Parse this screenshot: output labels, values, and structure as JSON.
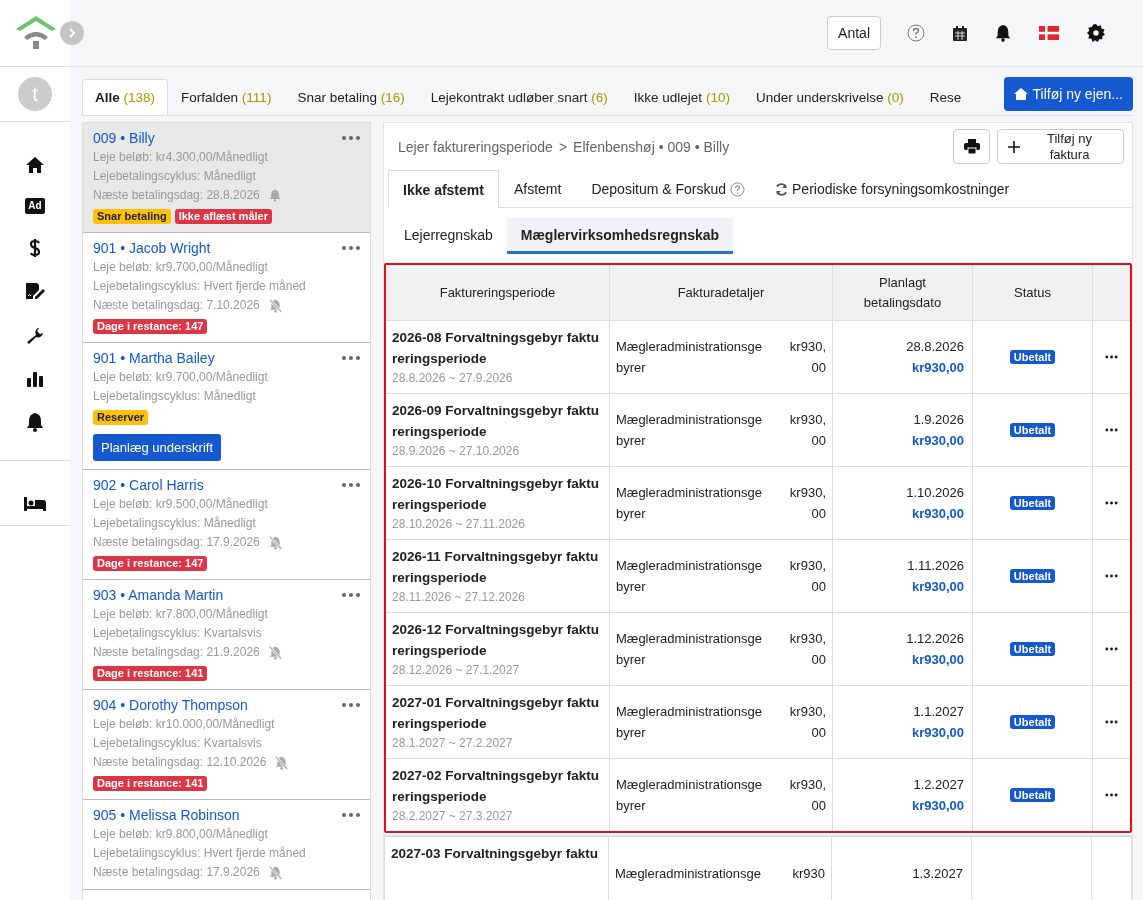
{
  "sidebar": {
    "avatar": "t",
    "nav": [
      {
        "kind": "home"
      },
      {
        "kind": "ad",
        "label": "Ad"
      },
      {
        "kind": "dollar"
      },
      {
        "kind": "contract"
      },
      {
        "kind": "wrench"
      },
      {
        "kind": "chart"
      },
      {
        "kind": "bell"
      }
    ],
    "bottom": [
      {
        "kind": "bed"
      }
    ]
  },
  "topbar": {
    "count_button": "Antal"
  },
  "filter_tabs": [
    {
      "label": "Alle",
      "count": "(138)",
      "selected": true
    },
    {
      "label": "Forfalden",
      "count": "(111)",
      "selected": false
    },
    {
      "label": "Snar betaling",
      "count": "(16)",
      "selected": false
    },
    {
      "label": "Lejekontrakt udløber snart",
      "count": "(6)",
      "selected": false
    },
    {
      "label": "Ikke udlejet",
      "count": "(10)",
      "selected": false
    },
    {
      "label": "Under underskrivelse",
      "count": "(0)",
      "selected": false
    },
    {
      "label": "Rese",
      "selected": false
    }
  ],
  "add_property_button": "Tilføj ny ejen...",
  "tenants": [
    {
      "title": "009 • Billy",
      "rent": "Leje beløb: kr4.300,00/Månedligt",
      "cycle": "Lejebetalingscyklus: Månedligt",
      "next": "Næste betalingsdag:  28.8.2026",
      "reminder_muted": false,
      "selected": true,
      "badges": [
        {
          "label": "Snar betaling",
          "color": "#ffc107"
        },
        {
          "label": "Ikke aflæst måler",
          "color": "#dc3545"
        }
      ]
    },
    {
      "title": "901 • Jacob Wright",
      "rent": "Leje beløb: kr9.700,00/Månedligt",
      "cycle": "Lejebetalingscyklus: Hvert fjerde måned",
      "next": "Næste betalingsdag:  7.10.2026",
      "reminder_muted": true,
      "selected": false,
      "badges": [
        {
          "label": "Dage i restance: 147",
          "color": "#dc3545"
        }
      ]
    },
    {
      "title": "901 • Martha Bailey",
      "rent": "Leje beløb: kr9.700,00/Månedligt",
      "cycle": "Lejebetalingscyklus: Månedligt",
      "selected": false,
      "badges": [
        {
          "label": "Reserver",
          "color": "#ffc107"
        }
      ],
      "action": "Planlæg underskrift"
    },
    {
      "title": "902 • Carol Harris",
      "rent": "Leje beløb: kr9.500,00/Månedligt",
      "cycle": "Lejebetalingscyklus: Månedligt",
      "next": "Næste betalingsdag:  17.9.2026",
      "reminder_muted": true,
      "selected": false,
      "badges": [
        {
          "label": "Dage i restance: 147",
          "color": "#dc3545"
        }
      ]
    },
    {
      "title": "903 • Amanda Martin",
      "rent": "Leje beløb: kr7.800,00/Månedligt",
      "cycle": "Lejebetalingscyklus: Kvartalsvis",
      "next": "Næste betalingsdag:  21.9.2026",
      "reminder_muted": true,
      "selected": false,
      "badges": [
        {
          "label": "Dage i restance: 141",
          "color": "#dc3545"
        }
      ]
    },
    {
      "title": "904 • Dorothy Thompson",
      "rent": "Leje beløb: kr10.000,00/Månedligt",
      "cycle": "Lejebetalingscyklus: Kvartalsvis",
      "next": "Næste betalingsdag:  12.10.2026",
      "reminder_muted": true,
      "selected": false,
      "badges": [
        {
          "label": "Dage i restance: 141",
          "color": "#dc3545"
        }
      ]
    },
    {
      "title": "905 • Melissa Robinson",
      "rent": "Leje beløb: kr9.800,00/Månedligt",
      "cycle": "Lejebetalingscyklus: Hvert fjerde måned",
      "next": "Næste betalingsdag:  17.9.2026",
      "reminder_muted": true,
      "selected": false
    }
  ],
  "detail": {
    "breadcrumb": {
      "parent": "Lejer faktureringsperiode",
      "separator": ">",
      "current": "Elfenbenshøj • 009 • Billy"
    },
    "add_invoice_button": "Tilføj ny faktura",
    "tabs": [
      {
        "label": "Ikke afstemt",
        "selected": true,
        "kind": "plain"
      },
      {
        "label": "Afstemt",
        "selected": false,
        "kind": "plain"
      },
      {
        "label": "Depositum & Forskud",
        "selected": false,
        "kind": "help"
      },
      {
        "label": "Periodiske forsyningsomkostninger",
        "selected": false,
        "kind": "refresh"
      }
    ],
    "subtabs": [
      {
        "label": "Lejerregnskab",
        "selected": false
      },
      {
        "label": "Mæglervirksomhedsregnskab",
        "selected": true
      }
    ],
    "table": {
      "columns": [
        "Faktureringsperiode",
        "Fakturadetaljer",
        "Planlagt betalingsdato",
        "Status"
      ],
      "rows": [
        {
          "period": "2026-08 Forvaltningsgebyr faktureringsperiode",
          "range": "28.8.2026 ~ 27.9.2026",
          "item": "Mægleradministrationsgebyrer",
          "item_amount": "kr930,00",
          "date": "28.8.2026",
          "amount": "kr930,00",
          "status": "Ubetalt",
          "highlighted": true
        },
        {
          "period": "2026-09 Forvaltningsgebyr faktureringsperiode",
          "range": "28.9.2026 ~ 27.10.2026",
          "item": "Mægleradministrationsgebyrer",
          "item_amount": "kr930,00",
          "date": "1.9.2026",
          "amount": "kr930,00",
          "status": "Ubetalt",
          "highlighted": true
        },
        {
          "period": "2026-10 Forvaltningsgebyr faktureringsperiode",
          "range": "28.10.2026 ~ 27.11.2026",
          "item": "Mægleradministrationsgebyrer",
          "item_amount": "kr930,00",
          "date": "1.10.2026",
          "amount": "kr930,00",
          "status": "Ubetalt",
          "highlighted": true
        },
        {
          "period": "2026-11 Forvaltningsgebyr faktureringsperiode",
          "range": "28.11.2026 ~ 27.12.2026",
          "item": "Mægleradministrationsgebyrer",
          "item_amount": "kr930,00",
          "date": "1.11.2026",
          "amount": "kr930,00",
          "status": "Ubetalt",
          "highlighted": true
        },
        {
          "period": "2026-12 Forvaltningsgebyr faktureringsperiode",
          "range": "28.12.2026 ~ 27.1.2027",
          "item": "Mægleradministrationsgebyrer",
          "item_amount": "kr930,00",
          "date": "1.12.2026",
          "amount": "kr930,00",
          "status": "Ubetalt",
          "highlighted": true
        },
        {
          "period": "2027-01 Forvaltningsgebyr faktureringsperiode",
          "range": "28.1.2027 ~ 27.2.2027",
          "item": "Mægleradministrationsgebyrer",
          "item_amount": "kr930,00",
          "date": "1.1.2027",
          "amount": "kr930,00",
          "status": "Ubetalt",
          "highlighted": true
        },
        {
          "period": "2027-02 Forvaltningsgebyr faktureringsperiode",
          "range": "28.2.2027 ~ 27.3.2027",
          "item": "Mægleradministrationsgebyrer",
          "item_amount": "kr930,00",
          "date": "1.2.2027",
          "amount": "kr930,00",
          "status": "Ubetalt",
          "highlighted": true
        },
        {
          "period": "2027-03 Forvaltningsgebyr faktu",
          "item": "Mægleradministrationsge",
          "item_amount": "kr930",
          "date": "1.3.2027",
          "highlighted": false
        }
      ]
    }
  }
}
